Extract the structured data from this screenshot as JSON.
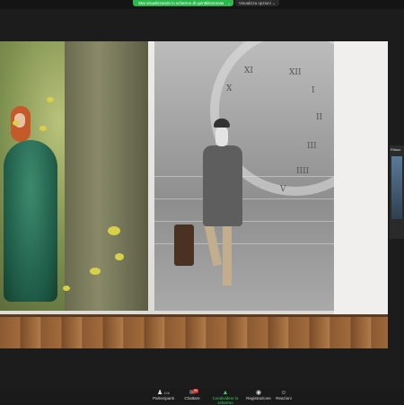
{
  "share_bar": {
    "status_text": "Stai visualizzando lo schermo di quinttiiitommas",
    "caret": "⌄",
    "view_options": "Visualizza opzioni ⌄"
  },
  "participant_tile": {
    "name": "Ritaso"
  },
  "clock_numerals": [
    "XII",
    "I",
    "II",
    "III",
    "IIII",
    "V",
    "X",
    "XI"
  ],
  "toolbar": {
    "participants": {
      "label": "Partecipanti",
      "count": "106",
      "icon": "people-icon"
    },
    "chat": {
      "label": "Chattare",
      "badge": "94",
      "icon": "chat-icon"
    },
    "share": {
      "label": "Condividere lo schermo",
      "icon": "share-screen-icon"
    },
    "record": {
      "label": "Registrazione",
      "icon": "record-icon"
    },
    "reactions": {
      "label": "Reazioni",
      "icon": "reaction-icon"
    }
  },
  "colors": {
    "share_green": "#2db84e",
    "chat_badge": "#e02828"
  }
}
